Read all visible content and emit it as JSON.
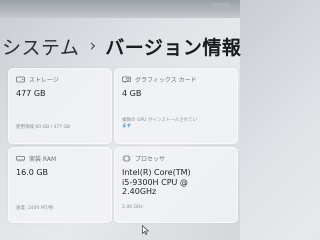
{
  "breadcrumb": {
    "parent": "システム",
    "separator": "›",
    "current": "バージョン情報"
  },
  "cards": {
    "storage": {
      "icon": "storage-drive-icon",
      "title": "ストレージ",
      "value": "477 GB",
      "sub": "使用領域 60 GB / 477 GB"
    },
    "gpu": {
      "icon": "graphics-card-icon",
      "title": "グラフィックス カード",
      "value": "4 GB",
      "sub": "複数の GPU がインストールされてい",
      "link": "ます"
    },
    "ram": {
      "icon": "memory-ram-icon",
      "title": "実装 RAM",
      "value": "16.0 GB",
      "sub": "速度: 2400 MT/秒"
    },
    "cpu": {
      "icon": "processor-chip-icon",
      "title": "プロセッサ",
      "value_lines": [
        "Intel(R) Core(TM)",
        "i5-9300H CPU @",
        "2.40GHz"
      ],
      "sub": "2.40 GHz"
    }
  },
  "colors": {
    "accent": "#0067c0",
    "card_bg": "#f4f5f7",
    "text_primary": "#1d2024",
    "text_secondary": "#6a6f75"
  }
}
